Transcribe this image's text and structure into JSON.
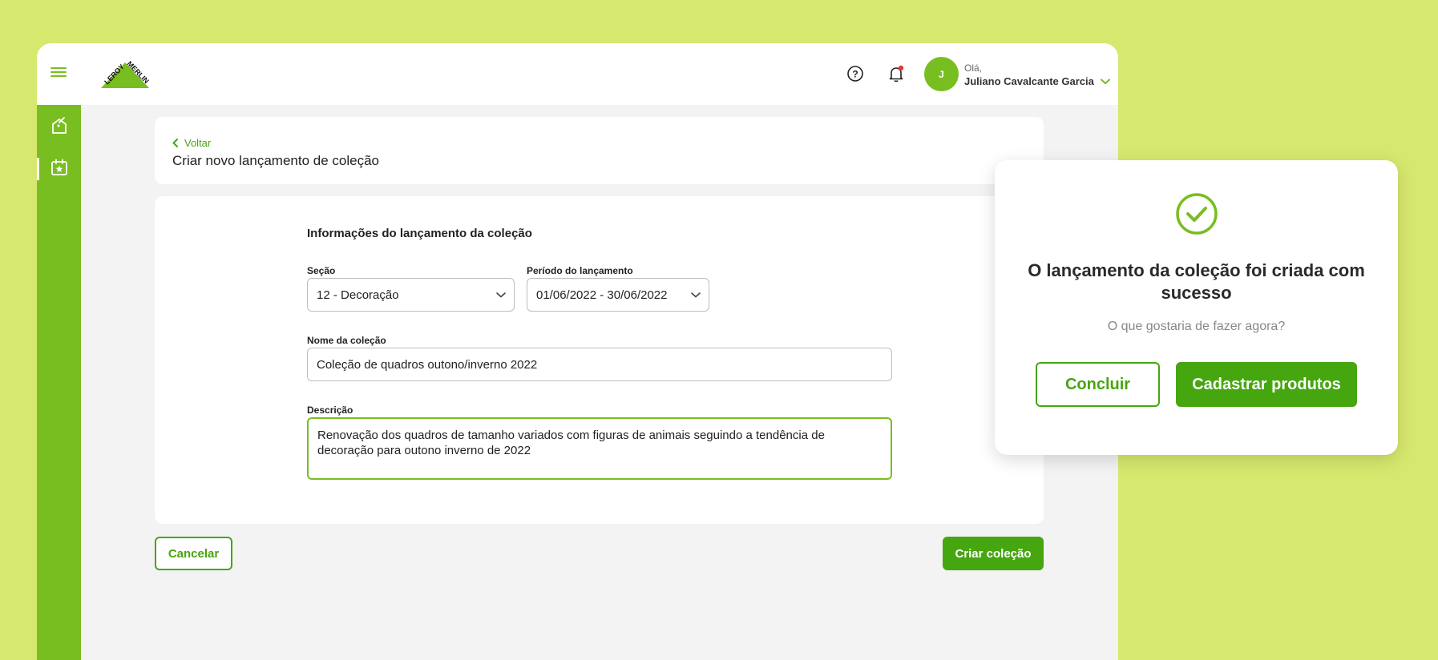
{
  "colors": {
    "background": "#d7e86e",
    "brand_green": "#78be20",
    "button_green": "#46a610",
    "notification_dot": "#e53935"
  },
  "header": {
    "logo_text": "LEROY MERLIN",
    "greeting": "Olá,",
    "user_name": "Juliano Cavalcante Garcia",
    "avatar_initial": "J",
    "icons": [
      "menu-icon",
      "help-icon",
      "bell-icon",
      "chevron-down-icon"
    ]
  },
  "sidebar": {
    "items": [
      {
        "icon": "house-tag-icon"
      },
      {
        "icon": "calendar-star-icon",
        "active": true
      }
    ]
  },
  "page": {
    "back_label": "Voltar",
    "title": "Criar novo lançamento de coleção"
  },
  "form": {
    "section_title": "Informações do lançamento da coleção",
    "secao_label": "Seção",
    "secao_value": "12 - Decoração",
    "periodo_label": "Período do lançamento",
    "periodo_value": "01/06/2022 - 30/06/2022",
    "nome_label": "Nome da coleção",
    "nome_value": "Coleção de quadros outono/inverno 2022",
    "descricao_label": "Descrição",
    "descricao_value": "Renovação dos quadros de tamanho variados com figuras de animais seguindo a tendência de decoração para outono inverno de 2022"
  },
  "actions": {
    "cancel_label": "Cancelar",
    "create_label": "Criar coleção"
  },
  "modal": {
    "title": "O lançamento da coleção foi criada com sucesso",
    "subtitle": "O que gostaria de fazer agora?",
    "conclude_label": "Concluir",
    "register_label": "Cadastrar produtos"
  }
}
